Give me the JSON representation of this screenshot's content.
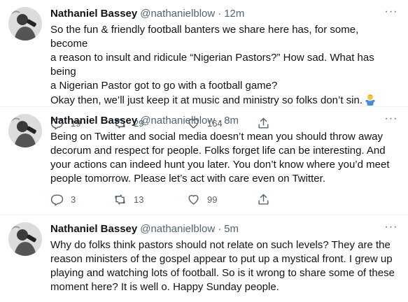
{
  "tweets": [
    {
      "name": "Nathaniel Bassey",
      "handle": "@nathanielblow",
      "separator": "·",
      "time": "12m",
      "text": "So the fun & friendly football banters we share here has, for some, become\na reason to insult and ridicule “Nigerian Pastors?” How sad. What has being\na Nigerian Pastor got to go with a football game?\nOkay then, we’ll just keep it at music and ministry so folks don’t sin.",
      "emoji_icon": "person-shrugging-emoji-icon",
      "replies": "19",
      "retweets": "29",
      "likes": "164"
    },
    {
      "name": "Nathaniel Bassey",
      "handle": "@nathanielblow",
      "separator": "·",
      "time": "8m",
      "text": "Being on Twitter and social media doesn’t mean you should throw away\ndecorum and respect for people. Folks forget life can be interesting. And\nyour actions can indeed hunt you later. You don’t know where you’d meet\npeople tomorrow. Please let’s act with care even on Twitter.",
      "replies": "3",
      "retweets": "13",
      "likes": "99"
    },
    {
      "name": "Nathaniel Bassey",
      "handle": "@nathanielblow",
      "separator": "·",
      "time": "5m",
      "text": "Why do folks think pastors should not relate on such levels? They are the\nreason ministers of the gospel appear to put up a mystical front. I grew up\nplaying and watching lots of football. So is it wrong to share some of these\nmoment here? It is well o. Happy Sunday people."
    }
  ],
  "colors": {
    "text": "#0f1419",
    "secondary": "#536471",
    "divider": "#eff3f4"
  },
  "icons": {
    "more": "more-horizontal-icon",
    "reply": "reply-icon",
    "retweet": "retweet-icon",
    "like": "heart-icon",
    "share": "share-icon"
  }
}
